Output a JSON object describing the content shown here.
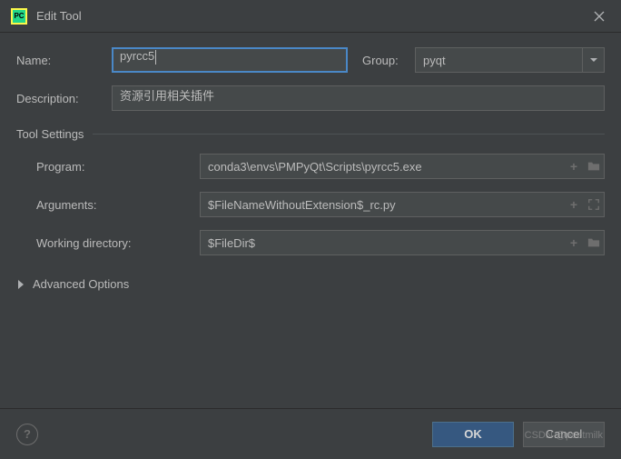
{
  "window": {
    "title": "Edit Tool"
  },
  "form": {
    "name_label": "Name:",
    "name_value": "pyrcc5",
    "group_label": "Group:",
    "group_value": "pyqt",
    "description_label": "Description:",
    "description_value": "资源引用相关插件"
  },
  "tool_settings": {
    "section_title": "Tool Settings",
    "program_label": "Program:",
    "program_value": "conda3\\envs\\PMPyQt\\Scripts\\pyrcc5.exe",
    "arguments_label": "Arguments:",
    "arguments_value": "$FileNameWithoutExtension$_rc.py",
    "workdir_label": "Working directory:",
    "workdir_value": "$FileDir$"
  },
  "advanced": {
    "label": "Advanced Options"
  },
  "buttons": {
    "ok": "OK",
    "cancel": "Cancel"
  },
  "watermark": "CSDN @poetmilk"
}
